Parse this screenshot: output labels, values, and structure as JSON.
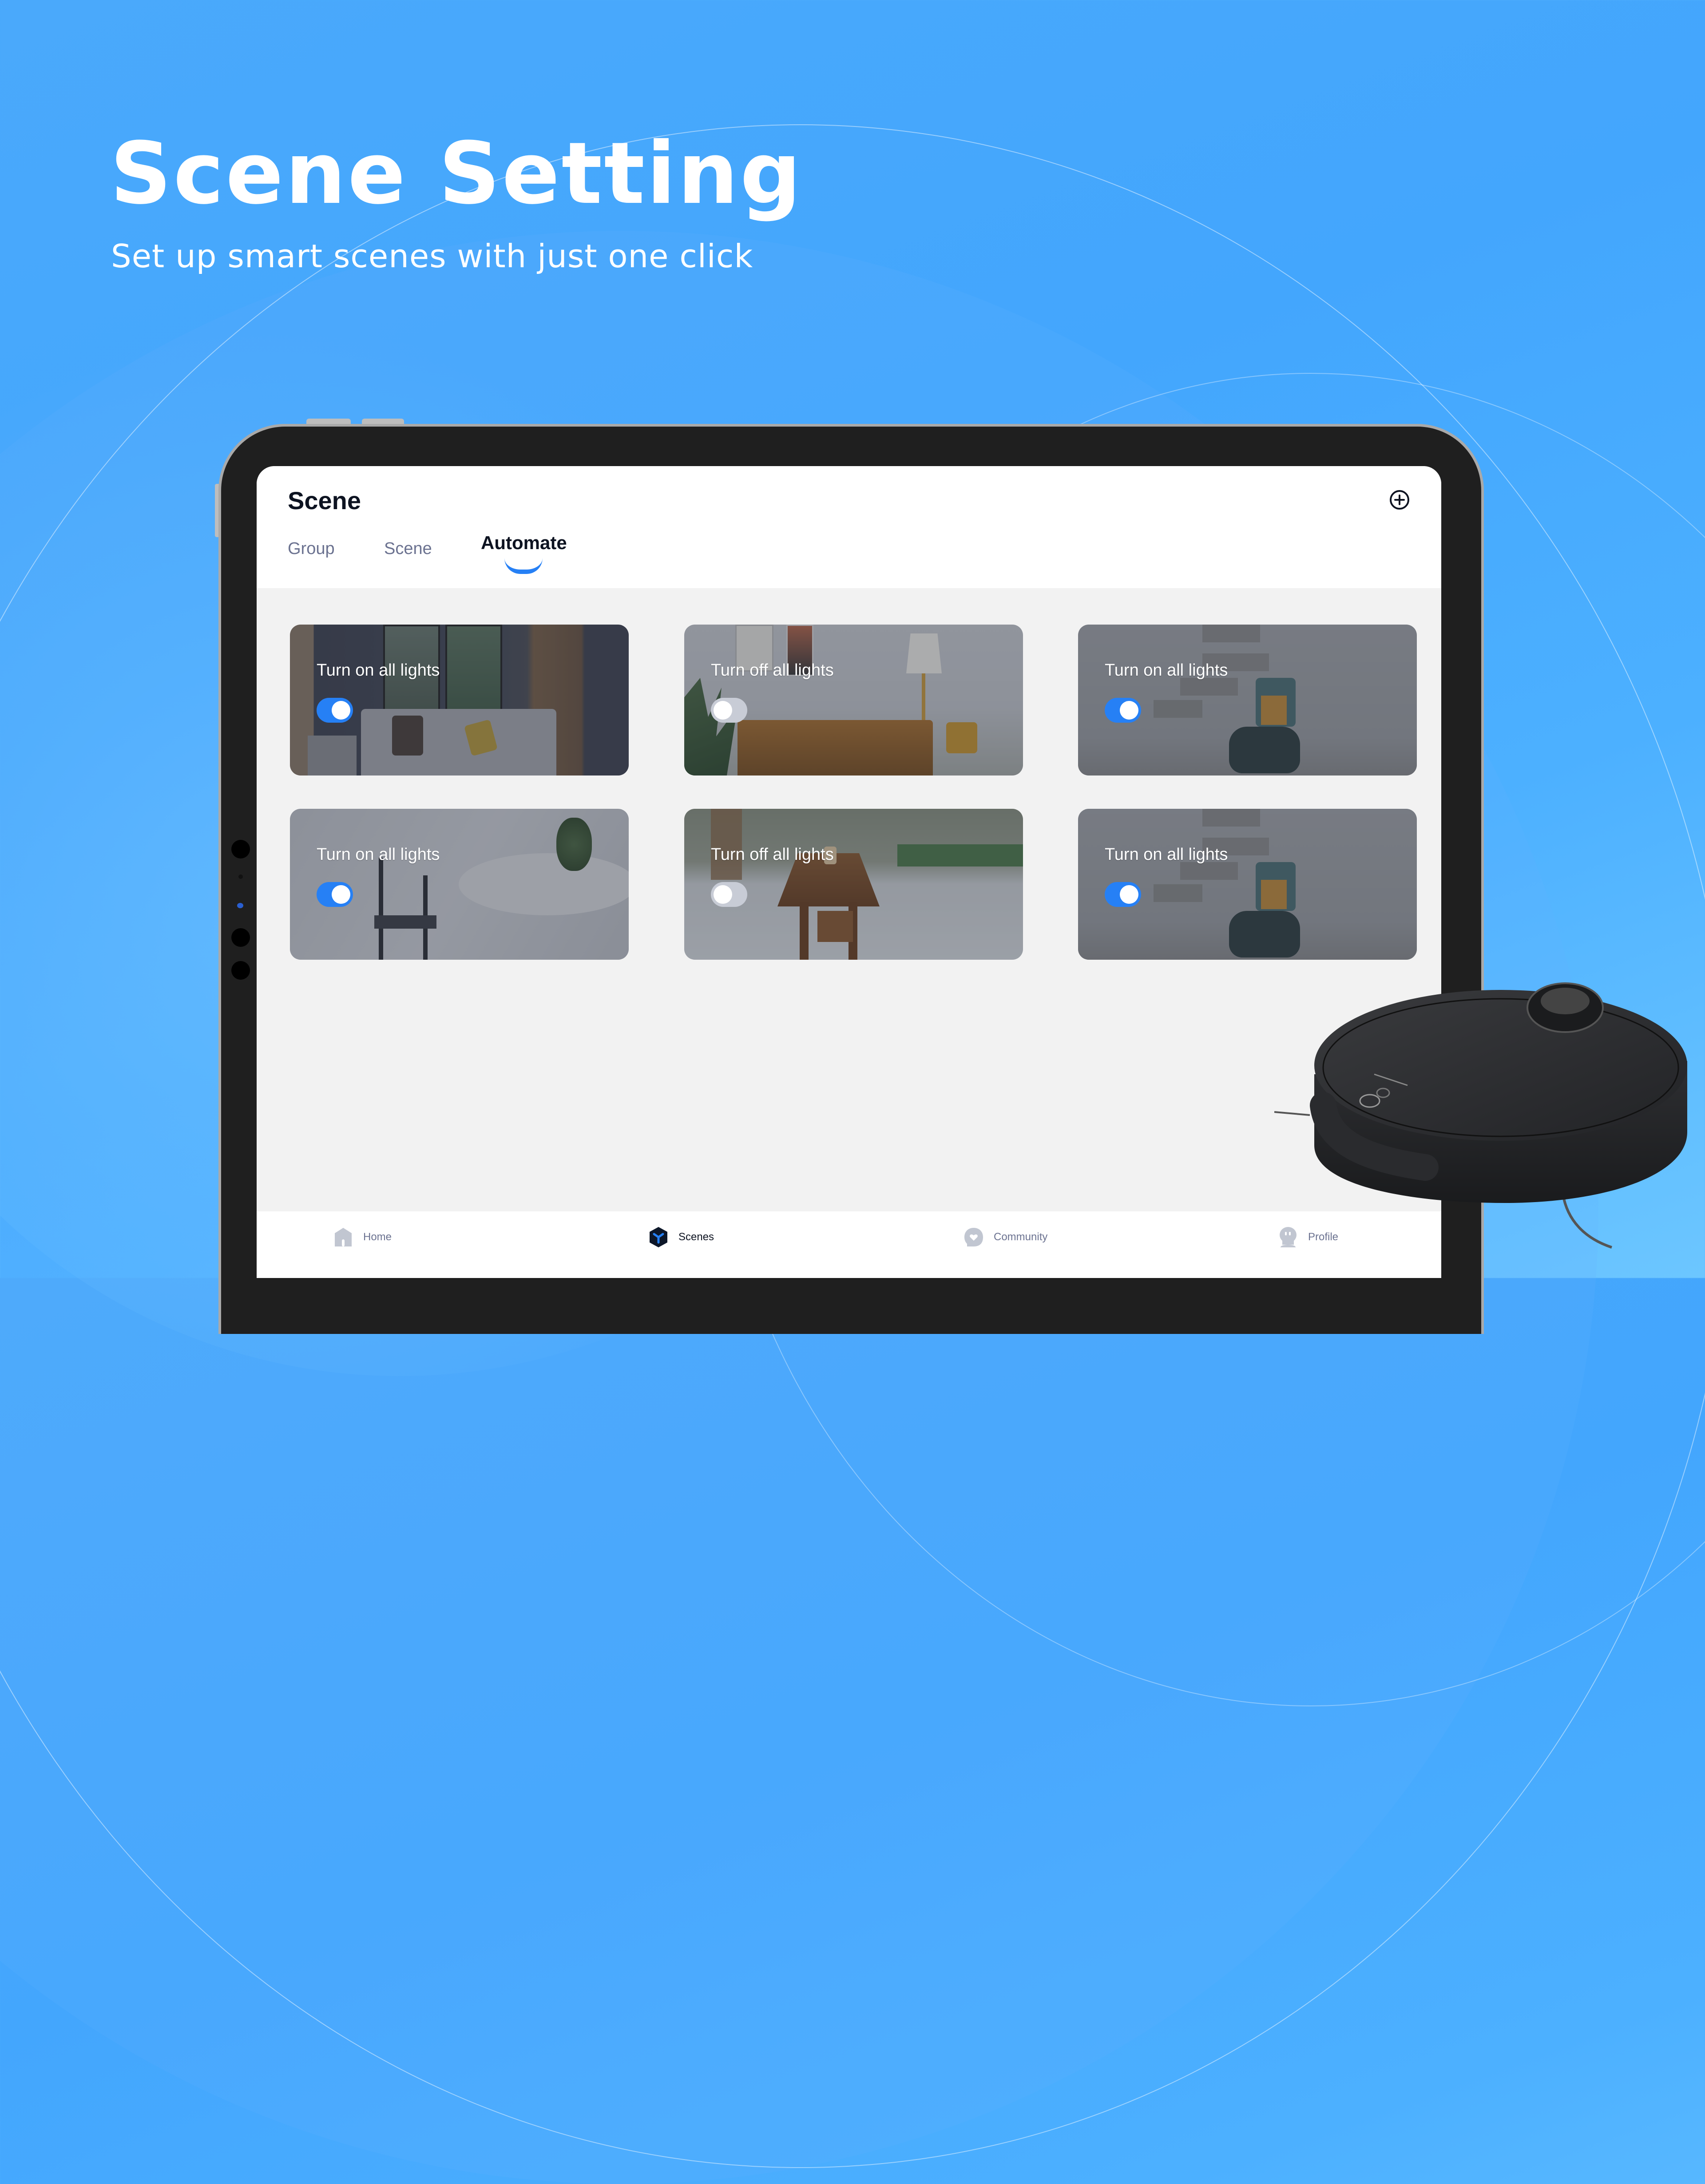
{
  "hero": {
    "title": "Scene Setting",
    "subtitle": "Set up smart scenes with just one click"
  },
  "app": {
    "page_title": "Scene",
    "add_icon": "plus-circle-icon",
    "tabs": [
      {
        "label": "Group",
        "active": false
      },
      {
        "label": "Scene",
        "active": false
      },
      {
        "label": "Automate",
        "active": true
      }
    ],
    "accent_color": "#2680f5",
    "automations": [
      {
        "label": "Turn on all lights",
        "enabled": true,
        "scene": "living-room-plants"
      },
      {
        "label": "Turn off all lights",
        "enabled": false,
        "scene": "leather-sofa-lamp"
      },
      {
        "label": "Turn on all lights",
        "enabled": true,
        "scene": "stairs-armchair"
      },
      {
        "label": "Turn on all lights",
        "enabled": true,
        "scene": "wishbone-chair-table"
      },
      {
        "label": "Turn off all lights",
        "enabled": false,
        "scene": "dining-table"
      },
      {
        "label": "Turn on all lights",
        "enabled": true,
        "scene": "stairs-armchair"
      }
    ],
    "bottom_nav": [
      {
        "label": "Home",
        "icon": "home-icon",
        "active": false
      },
      {
        "label": "Scenes",
        "icon": "scenes-cube-icon",
        "active": true
      },
      {
        "label": "Community",
        "icon": "community-heart-icon",
        "active": false
      },
      {
        "label": "Profile",
        "icon": "profile-icon",
        "active": false
      }
    ]
  }
}
